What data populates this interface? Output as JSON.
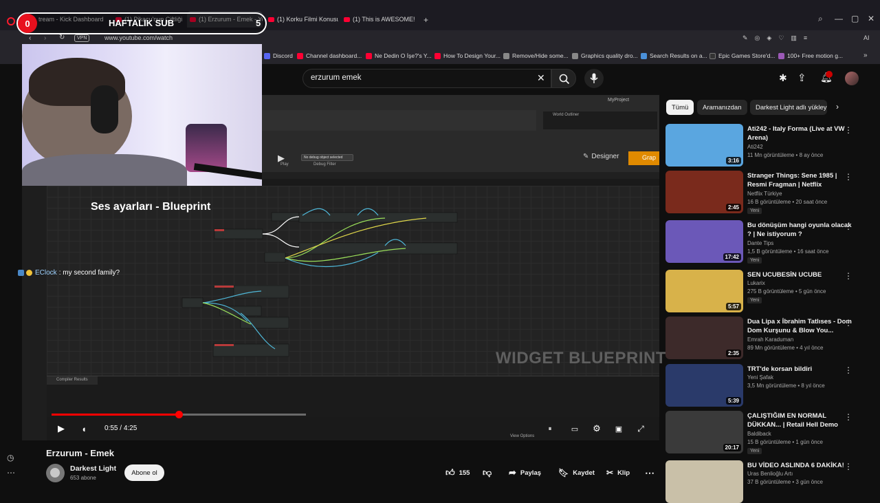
{
  "browser": {
    "tabs": [
      {
        "label": "tream - Kick Dashboard",
        "yt": false
      },
      {
        "label": "(1) Pikaçu'nun Çiftliği Kanal...",
        "yt": true
      },
      {
        "label": "(1) Erzurum - Emek - YouTube",
        "yt": true
      },
      {
        "label": "(1) Korku Filmi Konusunda...",
        "yt": true
      },
      {
        "label": "(1) This is AWESOME! - You...",
        "yt": true
      }
    ],
    "vpn": "VPN",
    "url": "www.youtube.com/watch",
    "ai_label": "AI",
    "bookmarks": [
      {
        "label": "Discord",
        "color": "#5865f2"
      },
      {
        "label": "Channel dashboard...",
        "color": "#ff0033"
      },
      {
        "label": "Ne Dedin O İşe?'s Y...",
        "color": "#ff0033"
      },
      {
        "label": "How To Design Your...",
        "color": "#ff0033"
      },
      {
        "label": "Remove/Hide some...",
        "color": "#888888"
      },
      {
        "label": "Graphics quality dro...",
        "color": "#888888"
      },
      {
        "label": "Search Results on a...",
        "color": "#4a90d9"
      },
      {
        "label": "Epic Games Store'd...",
        "color": "#333333"
      },
      {
        "label": "100+ Free motion g...",
        "color": "#9b59b6"
      }
    ]
  },
  "overlay": {
    "sub_counter_left": "0",
    "sub_label": "HAFTALIK SUB",
    "sub_counter_right": "5",
    "chat": {
      "user": "EClock",
      "message": ": my second family?"
    }
  },
  "youtube": {
    "search_value": "erzurum emek",
    "video": {
      "ue_project": "MyProject",
      "blueprint_heading": "Ses ayarları - Blueprint",
      "watermark": "WIDGET BLUEPRINT",
      "play_label": "Play",
      "debug_select": "No debug object selected",
      "debug_filter": "Debug Filter",
      "designer_label": "Designer",
      "graph_label": "Grap",
      "compiler_results": "Compiler Results",
      "view_options": "View Options",
      "world_outliner": "World Outliner",
      "current_time": "0:55",
      "duration": "4:25",
      "progress_fraction": 0.5
    },
    "title": "Erzurum - Emek",
    "channel": {
      "name": "Darkest Light",
      "subs": "653 abone"
    },
    "subscribe_label": "Abone ol",
    "likes": "155",
    "share_label": "Paylaş",
    "save_label": "Kaydet",
    "clip_label": "Klip",
    "chips": [
      "Tümü",
      "Aramanızdan",
      "Darkest Light adlı yükley"
    ],
    "recommendations": [
      {
        "title": "Ati242 - Italy Forma (Live at VW Arena)",
        "channel": "Ati242",
        "meta": "11 Mn görüntüleme • 8 ay önce",
        "duration": "3:16",
        "badge": "",
        "thumb_color": "#5aa6e0"
      },
      {
        "title": "Stranger Things: Sene 1985 | Resmi Fragman | Netflix",
        "channel": "Netflix Türkiye",
        "meta": "16 B görüntüleme • 20 saat önce",
        "duration": "2:45",
        "badge": "Yeni",
        "thumb_color": "#7a2a1c"
      },
      {
        "title": "Bu dönüşüm hangi oyunla olacak ? | Ne istiyorum ?",
        "channel": "Dante Tips",
        "meta": "1,5 B görüntüleme • 16 saat önce",
        "duration": "17:42",
        "badge": "Yeni",
        "thumb_color": "#6b58b8"
      },
      {
        "title": "SEN UCUBESİN UCUBE",
        "channel": "Lukarix",
        "meta": "275 B görüntüleme • 5 gün önce",
        "duration": "5:57",
        "badge": "Yeni",
        "thumb_color": "#d8b24a"
      },
      {
        "title": "Dua Lipa x İbrahim Tatlıses - Dom Dom Kurşunu & Blow You...",
        "channel": "Emrah Karaduman",
        "meta": "89 Mn görüntüleme • 4 yıl önce",
        "duration": "2:35",
        "badge": "",
        "thumb_color": "#3d2a2a"
      },
      {
        "title": "TRT'de korsan bildiri",
        "channel": "Yeni Şafak",
        "meta": "3,5 Mn görüntüleme • 8 yıl önce",
        "duration": "5:39",
        "badge": "",
        "thumb_color": "#2a3a6a"
      },
      {
        "title": "ÇALIŞTIĞIM EN NORMAL DÜKKAN... | Retail Hell Demo",
        "channel": "Baldiback",
        "meta": "15 B görüntüleme • 1 gün önce",
        "duration": "20:17",
        "badge": "Yeni",
        "thumb_color": "#3a3a3a"
      },
      {
        "title": "BU VİDEO ASLINDA 6 DAKİKA!",
        "channel": "Uras Benlioğlu Artı",
        "meta": "37 B görüntüleme • 3 gün önce",
        "duration": "",
        "badge": "",
        "thumb_color": "#c9c0a8"
      }
    ]
  }
}
